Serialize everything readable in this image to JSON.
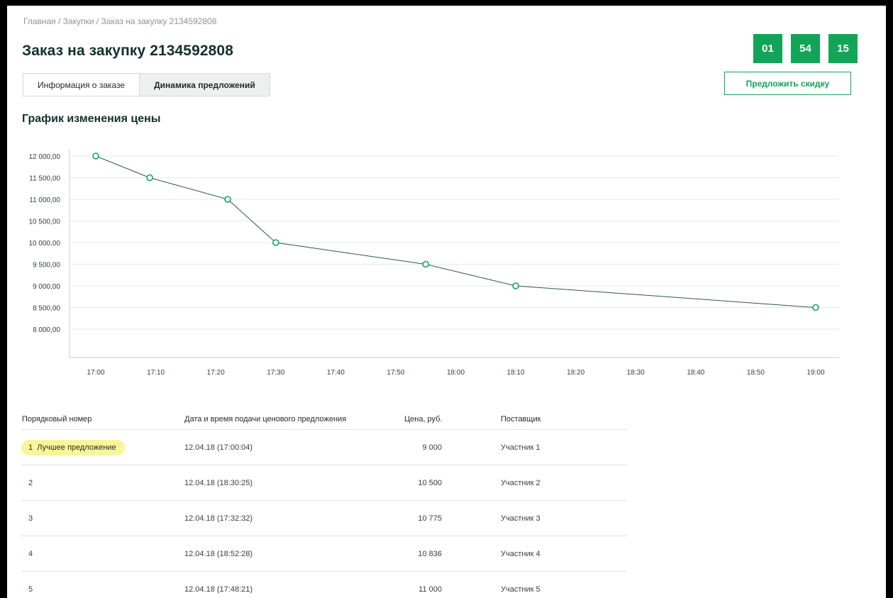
{
  "breadcrumb": "Главная / Закупки / Заказ на закупку 2134592808",
  "page_title": "Заказ на закупку 2134592808",
  "tabs": [
    {
      "label": "Информация о заказе",
      "active": false
    },
    {
      "label": "Динамика предложений",
      "active": true
    }
  ],
  "timer": {
    "hours": "01",
    "minutes": "54",
    "seconds": "15"
  },
  "discount_button": "Предложить скидку",
  "chart_title": "График изменения цены",
  "colors": {
    "accent": "#12a557",
    "line": "#2e5a4c",
    "grid": "#e6e9e8",
    "badge": "#fbf59a"
  },
  "chart_data": {
    "type": "line",
    "title": "График изменения цены",
    "x_ticks": [
      "17:00",
      "17:10",
      "17:20",
      "17:30",
      "17:40",
      "17:50",
      "18:00",
      "18:10",
      "18:20",
      "18:30",
      "18:40",
      "18:50",
      "19:00"
    ],
    "y_ticks": [
      "12 000,00",
      "11 500,00",
      "11 000,00",
      "10 500,00",
      "10 000,00",
      "9 500,00",
      "9 000,00",
      "8 500,00",
      "8 000,00"
    ],
    "ylim": [
      8000,
      12000
    ],
    "xlim": [
      "17:00",
      "19:00"
    ],
    "grid": true,
    "series": [
      {
        "points": [
          {
            "x": "17:00",
            "y": 12000
          },
          {
            "x": "17:09",
            "y": 11500
          },
          {
            "x": "17:22",
            "y": 11000
          },
          {
            "x": "17:30",
            "y": 10000
          },
          {
            "x": "17:55",
            "y": 9500
          },
          {
            "x": "18:10",
            "y": 9000
          },
          {
            "x": "19:00",
            "y": 8500
          }
        ]
      }
    ]
  },
  "table": {
    "headers": [
      "Порядковый номер",
      "Дата и время подачи ценового предложения",
      "Цена,  руб.",
      "Поставщик"
    ],
    "rows": [
      {
        "num": "1",
        "best_label": "Лучшее предложение",
        "datetime": "12.04.18 (17:00:04)",
        "price": "9 000",
        "supplier": "Участник 1"
      },
      {
        "num": "2",
        "datetime": "12.04.18 (18:30:25)",
        "price": "10 500",
        "supplier": "Участник 2"
      },
      {
        "num": "3",
        "datetime": "12.04.18 (17:32:32)",
        "price": "10 775",
        "supplier": "Участник 3"
      },
      {
        "num": "4",
        "datetime": "12.04.18 (18:52:28)",
        "price": "10 836",
        "supplier": "Участник 4"
      },
      {
        "num": "5",
        "datetime": "12.04.18 (17:48:21)",
        "price": "11 000",
        "supplier": "Участник 5"
      }
    ]
  }
}
